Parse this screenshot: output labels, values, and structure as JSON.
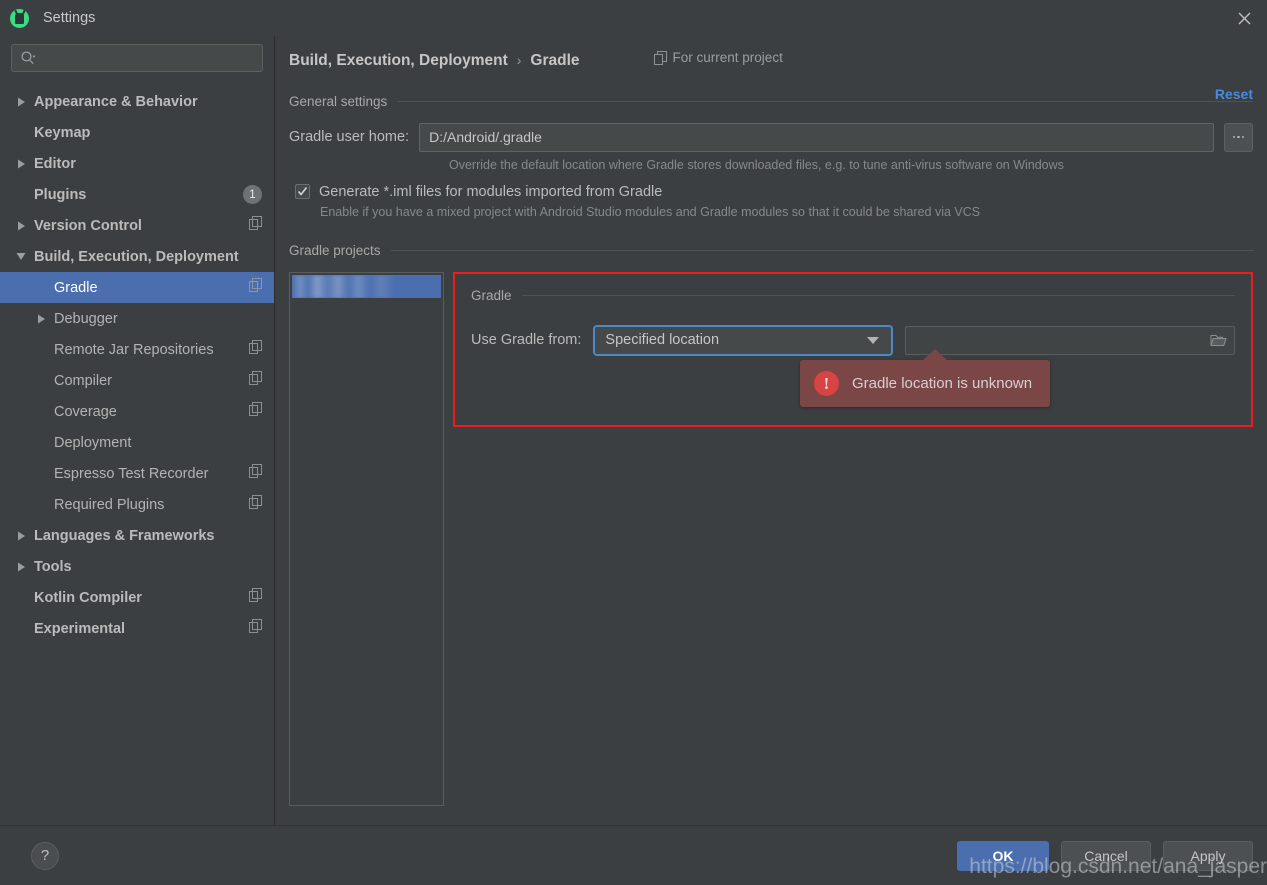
{
  "window": {
    "title": "Settings",
    "logo_icon": "android-studio-icon",
    "close_icon": "close-icon"
  },
  "search": {
    "placeholder": "",
    "value": "",
    "icon": "search-icon"
  },
  "sidebar": {
    "items": [
      {
        "label": "Appearance & Behavior",
        "level": 0,
        "arrow": "collapsed",
        "bold": true,
        "badge": "",
        "scope_icon": false,
        "selected": false
      },
      {
        "label": "Keymap",
        "level": 0,
        "arrow": "none",
        "bold": true,
        "badge": "",
        "scope_icon": false,
        "selected": false
      },
      {
        "label": "Editor",
        "level": 0,
        "arrow": "collapsed",
        "bold": true,
        "badge": "",
        "scope_icon": false,
        "selected": false
      },
      {
        "label": "Plugins",
        "level": 0,
        "arrow": "none",
        "bold": true,
        "badge": "1",
        "scope_icon": false,
        "selected": false
      },
      {
        "label": "Version Control",
        "level": 0,
        "arrow": "collapsed",
        "bold": true,
        "badge": "",
        "scope_icon": true,
        "selected": false
      },
      {
        "label": "Build, Execution, Deployment",
        "level": 0,
        "arrow": "expanded",
        "bold": true,
        "badge": "",
        "scope_icon": false,
        "selected": false
      },
      {
        "label": "Gradle",
        "level": 1,
        "arrow": "none",
        "bold": false,
        "badge": "",
        "scope_icon": true,
        "selected": true
      },
      {
        "label": "Debugger",
        "level": 1,
        "arrow": "collapsed",
        "bold": false,
        "badge": "",
        "scope_icon": false,
        "selected": false
      },
      {
        "label": "Remote Jar Repositories",
        "level": 1,
        "arrow": "none",
        "bold": false,
        "badge": "",
        "scope_icon": true,
        "selected": false
      },
      {
        "label": "Compiler",
        "level": 1,
        "arrow": "none",
        "bold": false,
        "badge": "",
        "scope_icon": true,
        "selected": false
      },
      {
        "label": "Coverage",
        "level": 1,
        "arrow": "none",
        "bold": false,
        "badge": "",
        "scope_icon": true,
        "selected": false
      },
      {
        "label": "Deployment",
        "level": 1,
        "arrow": "none",
        "bold": false,
        "badge": "",
        "scope_icon": false,
        "selected": false
      },
      {
        "label": "Espresso Test Recorder",
        "level": 1,
        "arrow": "none",
        "bold": false,
        "badge": "",
        "scope_icon": true,
        "selected": false
      },
      {
        "label": "Required Plugins",
        "level": 1,
        "arrow": "none",
        "bold": false,
        "badge": "",
        "scope_icon": true,
        "selected": false
      },
      {
        "label": "Languages & Frameworks",
        "level": 0,
        "arrow": "collapsed",
        "bold": true,
        "badge": "",
        "scope_icon": false,
        "selected": false
      },
      {
        "label": "Tools",
        "level": 0,
        "arrow": "collapsed",
        "bold": true,
        "badge": "",
        "scope_icon": false,
        "selected": false
      },
      {
        "label": "Kotlin Compiler",
        "level": 0,
        "arrow": "none",
        "bold": true,
        "badge": "",
        "scope_icon": true,
        "selected": false
      },
      {
        "label": "Experimental",
        "level": 0,
        "arrow": "none",
        "bold": true,
        "badge": "",
        "scope_icon": true,
        "selected": false
      }
    ]
  },
  "header": {
    "breadcrumb_parent": "Build, Execution, Deployment",
    "breadcrumb_separator": "›",
    "breadcrumb_current": "Gradle",
    "scope_text": "For current project",
    "scope_icon": "project-scope-icon",
    "reset_label": "Reset"
  },
  "general": {
    "section_title": "General settings",
    "user_home_label": "Gradle user home:",
    "user_home_value": "D:/Android/.gradle",
    "user_home_placeholder": "",
    "browse_icon": "ellipsis-button",
    "user_home_hint": "Override the default location where Gradle stores downloaded files, e.g. to tune anti-virus software on Windows",
    "generate_iml_label": "Generate *.iml files for modules imported from Gradle",
    "generate_iml_checked": true,
    "generate_iml_hint": "Enable if you have a mixed project with Android Studio modules and Gradle modules so that it could be shared via VCS"
  },
  "projects": {
    "section_title": "Gradle projects",
    "items": [
      {
        "label": "",
        "selected": true,
        "redacted": true
      }
    ]
  },
  "gradle_panel": {
    "section_title": "Gradle",
    "use_gradle_from_label": "Use Gradle from:",
    "use_gradle_from_value": "Specified location",
    "use_gradle_from_options": [
      "Specified location"
    ],
    "location_value": "",
    "location_placeholder": "",
    "folder_icon": "folder-icon",
    "highlight_color": "#f01b1b"
  },
  "error_tooltip": {
    "message": "Gradle location is unknown",
    "icon": "error-exclamation-icon",
    "background_color": "#7a4646",
    "icon_color": "#d84343"
  },
  "footer": {
    "help_label": "?",
    "ok_label": "OK",
    "cancel_label": "Cancel",
    "apply_label": "Apply",
    "primary_color": "#4b6eaf"
  },
  "watermark": {
    "text": "https://blog.csdn.net/ana_jasper"
  }
}
